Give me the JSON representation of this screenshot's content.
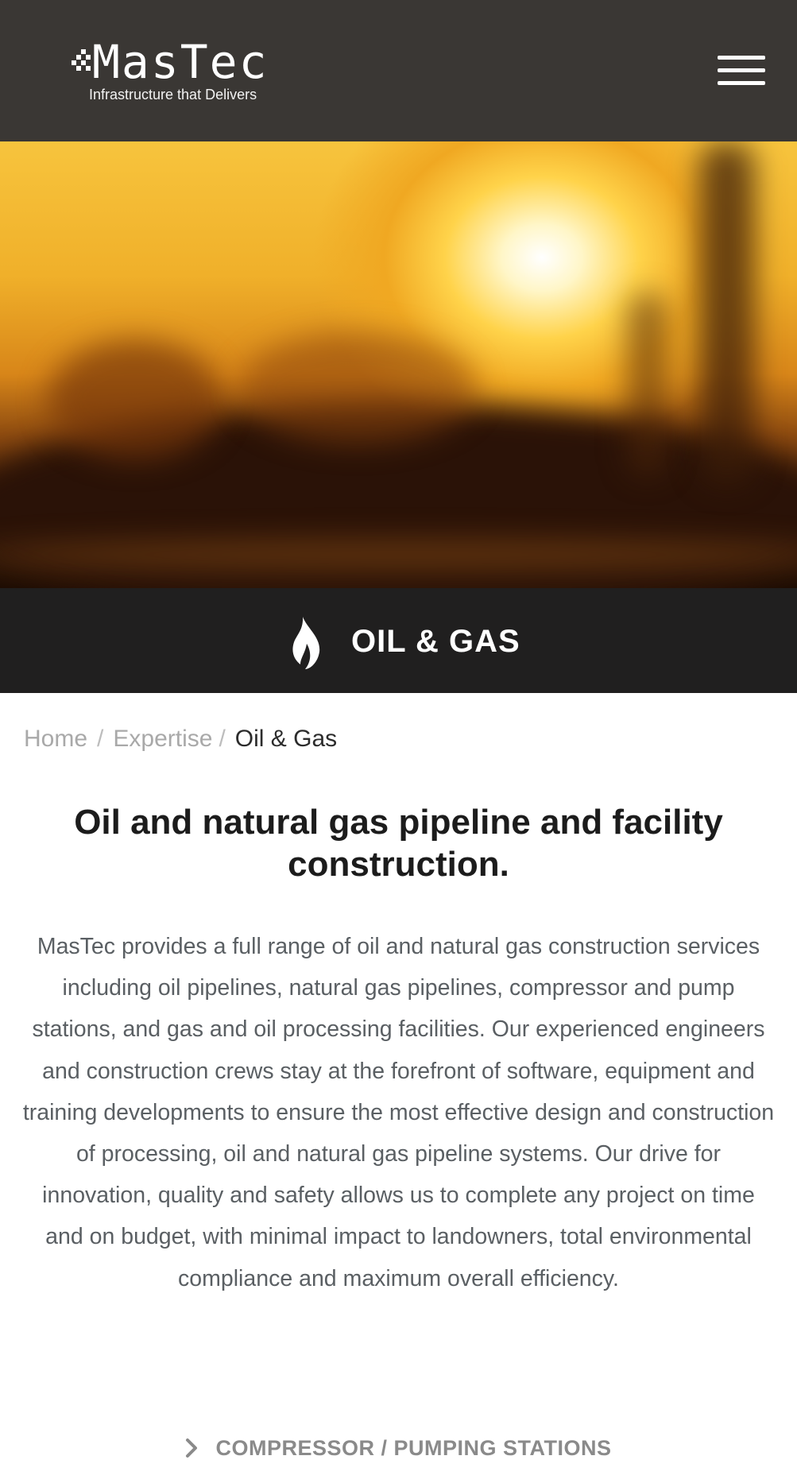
{
  "header": {
    "logo_name": "MasTec",
    "logo_tagline": "Infrastructure that Delivers",
    "menu_icon": "hamburger-menu-icon"
  },
  "hero": {
    "image_description_icon": "sunset-industrial-photo"
  },
  "title_band": {
    "icon": "flame-icon",
    "title": "OIL & GAS"
  },
  "breadcrumb": {
    "items": [
      "Home",
      "Expertise",
      "Oil & Gas"
    ],
    "separator": "/"
  },
  "main": {
    "heading": "Oil and natural gas pipeline and facility construction.",
    "body": "MasTec provides a full range of oil and natural gas construction services including oil pipelines, natural gas pipelines, compressor and pump stations, and gas and oil processing facilities. Our experienced engineers and construction crews stay at the forefront of software, equipment and training developments to ensure the most effective design and construction of processing, oil and natural gas pipeline systems. Our drive for innovation, quality and safety allows us to complete any project on time and on budget, with minimal impact to landowners, total environmental compliance and maximum overall efficiency."
  },
  "expandable": {
    "items": [
      {
        "label": "COMPRESSOR / PUMPING STATIONS",
        "icon": "chevron-right-icon"
      }
    ]
  },
  "colors": {
    "header_bg": "#3a3734",
    "band_bg": "#201f1f",
    "heading_text": "#1c1c1c",
    "body_text": "#5a5f63",
    "muted_text": "#a9a9a9"
  }
}
